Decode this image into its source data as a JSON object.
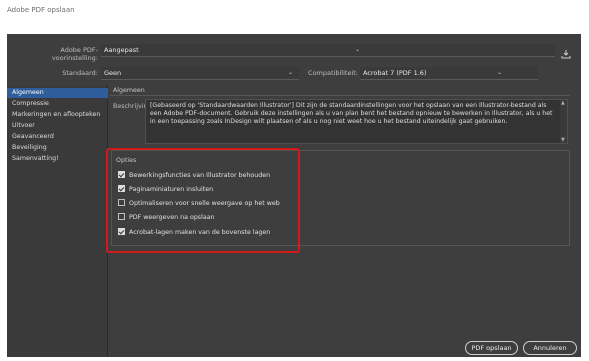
{
  "window": {
    "title": "Adobe PDF opslaan"
  },
  "preset": {
    "label": "Adobe PDF-voorinstelling:",
    "value": "Aangepast"
  },
  "standard": {
    "label": "Standaard:",
    "value": "Geen"
  },
  "compatibility": {
    "label": "Compatibiliteit:",
    "value": "Acrobat 7 (PDF 1.6)"
  },
  "sidebar": {
    "items": [
      {
        "label": "Algemeen"
      },
      {
        "label": "Compressie"
      },
      {
        "label": "Markeringen en afloopteken"
      },
      {
        "label": "Uitvoer"
      },
      {
        "label": "Geavanceerd"
      },
      {
        "label": "Beveiliging"
      },
      {
        "label": "Samenvatting!"
      }
    ]
  },
  "section": {
    "title": "Algemeen"
  },
  "description": {
    "label": "Beschrijving:",
    "text": "[Gebaseerd op 'Standaardwaarden Illustrator'] Dit zijn de standaardinstellingen voor het opslaan van een Illustrator-bestand als een Adobe PDF-document. Gebruik deze instellingen als u van plan bent het bestand opnieuw te bewerken in Illustrator, als u het in een toepassing zoals InDesign wilt plaatsen of als u nog niet weet hoe u het bestand uiteindelijk gaat gebruiken."
  },
  "options": {
    "title": "Opties",
    "items": [
      {
        "label": "Bewerkingsfuncties van Illustrator behouden",
        "checked": true
      },
      {
        "label": "Paginaminiaturen insluiten",
        "checked": true
      },
      {
        "label": "Optimaliseren voor snelle weergave op het web",
        "checked": false
      },
      {
        "label": "PDF weergeven na opslaan",
        "checked": false
      },
      {
        "label": "Acrobat-lagen maken van de bovenste lagen",
        "checked": true
      }
    ]
  },
  "buttons": {
    "save": "PDF opslaan",
    "cancel": "Annuleren"
  },
  "colors": {
    "highlight": "#d11a1a",
    "active_item": "#2f5d9c"
  }
}
